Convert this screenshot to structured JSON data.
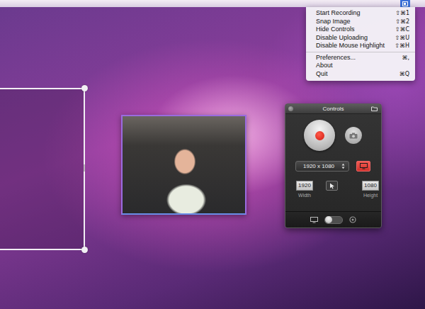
{
  "menu_bar": {
    "status_icon": {
      "selected": true
    }
  },
  "menu": {
    "items": [
      {
        "kind": "item",
        "label": "Start Recording",
        "shortcut": "⇧⌘1"
      },
      {
        "kind": "item",
        "label": "Snap Image",
        "shortcut": "⇧⌘2"
      },
      {
        "kind": "item",
        "label": "Hide Controls",
        "shortcut": "⇧⌘C"
      },
      {
        "kind": "item",
        "label": "Disable Uploading",
        "shortcut": "⇧⌘U"
      },
      {
        "kind": "item",
        "label": "Disable Mouse Highlight",
        "shortcut": "⇧⌘H"
      },
      {
        "kind": "separator"
      },
      {
        "kind": "item",
        "label": "Preferences...",
        "shortcut": "⌘,"
      },
      {
        "kind": "item",
        "label": "About",
        "shortcut": ""
      },
      {
        "kind": "item",
        "label": "Quit",
        "shortcut": "⌘Q"
      }
    ]
  },
  "controls": {
    "title": "Controls",
    "resolution": "1920 x 1080",
    "capture_area_button": {
      "selected": true
    },
    "width": {
      "value": "1920",
      "label": "Width"
    },
    "height": {
      "value": "1080",
      "label": "Height"
    },
    "toggle": {
      "on": false
    }
  }
}
